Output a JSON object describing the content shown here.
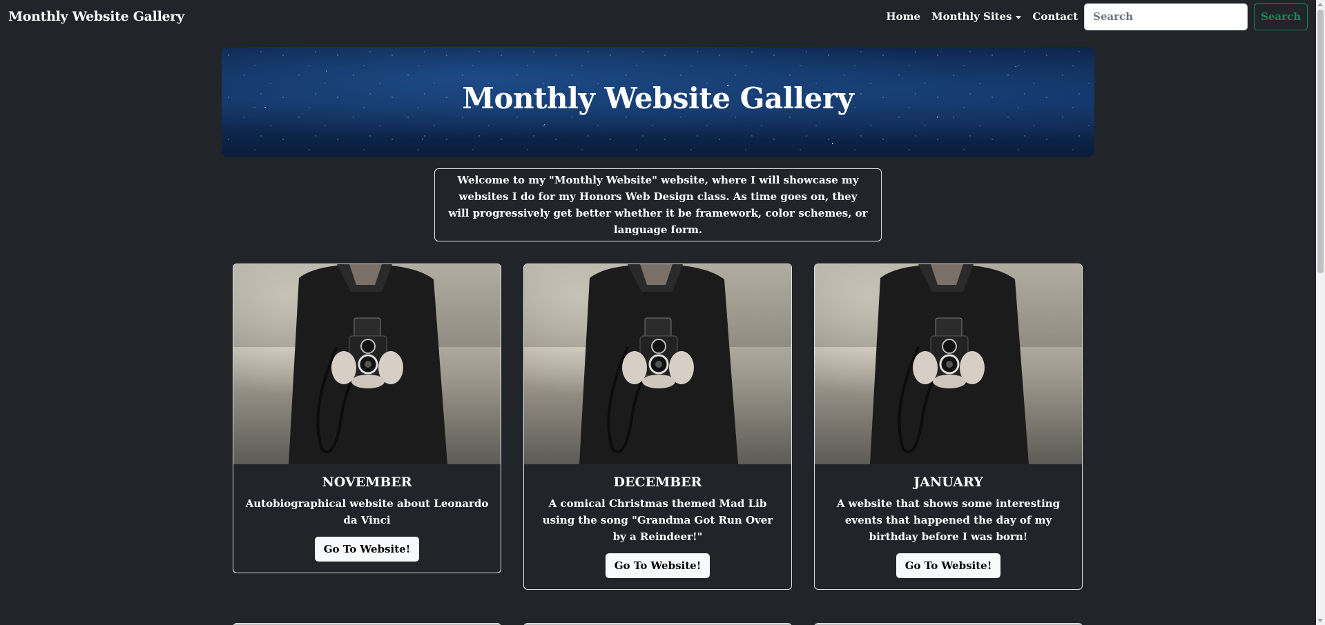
{
  "navbar": {
    "brand": "Monthly Website Gallery",
    "links": [
      "Home",
      "Monthly Sites",
      "Contact"
    ],
    "search_placeholder": "Search",
    "search_button": "Search"
  },
  "hero": {
    "title": "Monthly Website Gallery"
  },
  "intro": {
    "text": "Welcome to my \"Monthly Website\" website, where I will showcase my websites I do for my Honors Web Design class. As time goes on, they will progressively get better whether it be framework, color schemes, or language form."
  },
  "cards": [
    {
      "title": "NOVEMBER",
      "text": "Autobiographical website about Leonardo da Vinci",
      "button": "Go To Website!"
    },
    {
      "title": "DECEMBER",
      "text": "A comical Christmas themed Mad Lib using the song \"Grandma Got Run Over by a Reindeer!\"",
      "button": "Go To Website!"
    },
    {
      "title": "JANUARY",
      "text": "A website that shows some interesting events that happened the day of my birthday before I was born!",
      "button": "Go To Website!"
    }
  ],
  "colors": {
    "background": "#212529",
    "search_button": "#198754",
    "card_border": "#dee2e6"
  }
}
